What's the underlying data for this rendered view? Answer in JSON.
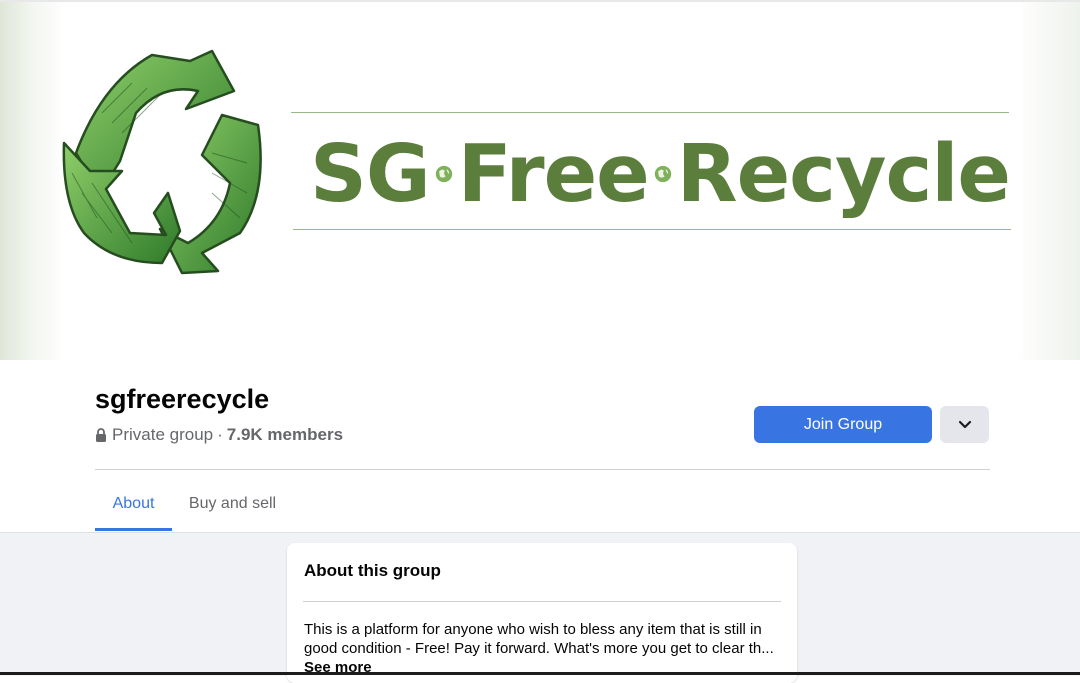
{
  "cover": {
    "brand_parts": [
      "SG",
      "Free",
      "Recycle"
    ],
    "brand_color": "#5c7e3d",
    "logo_icon": "recycle-icon"
  },
  "group": {
    "name": "sgfreerecycle",
    "privacy": "Private group",
    "separator": "·",
    "members": "7.9K members"
  },
  "actions": {
    "join_label": "Join Group",
    "more_icon": "chevron-down-icon"
  },
  "tabs": [
    {
      "label": "About",
      "active": true
    },
    {
      "label": "Buy and sell",
      "active": false
    }
  ],
  "about": {
    "title": "About this group",
    "description": "This is a platform for anyone who wish to bless any item that is still in good condition - Free! Pay it forward. What's more you get to clear th...",
    "see_more": "See more"
  },
  "colors": {
    "accent": "#3875e3",
    "page_bg": "#f0f2f5",
    "muted_text": "#65676b"
  }
}
